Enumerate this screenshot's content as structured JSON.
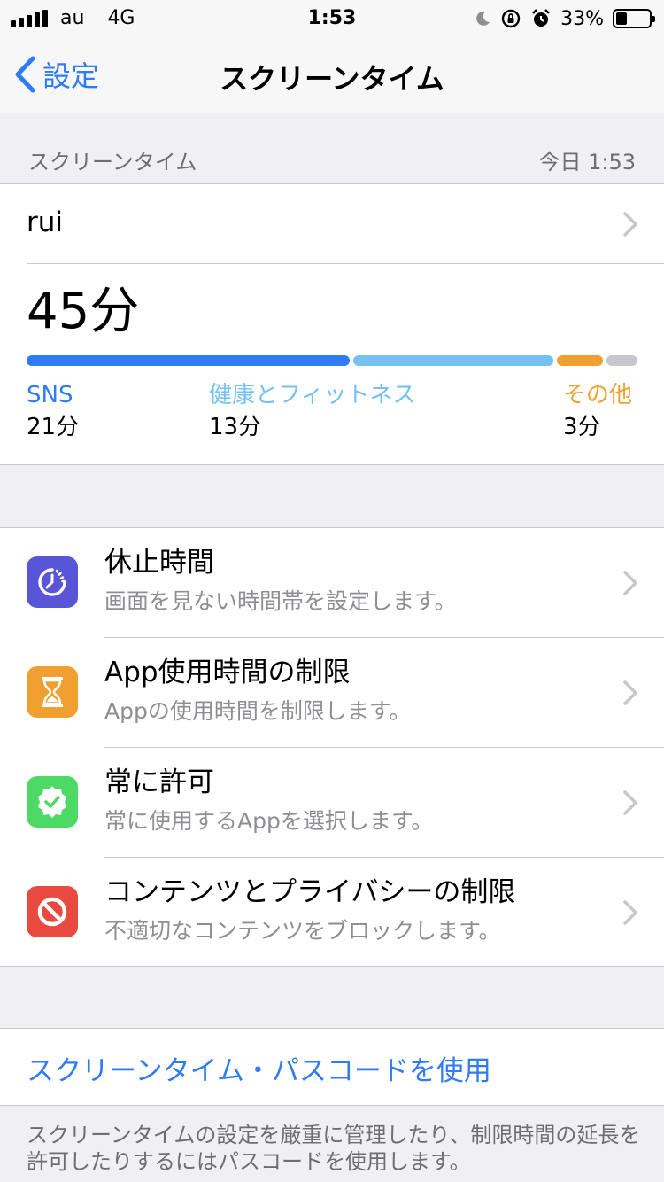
{
  "status_bar": {
    "carrier": "au",
    "network": "4G",
    "time": "1:53",
    "battery_text": "33%",
    "battery_level": 0.33
  },
  "nav": {
    "back_label": "設定",
    "title": "スクリーンタイム"
  },
  "section": {
    "title": "スクリーンタイム",
    "date": "今日 1:53"
  },
  "usage": {
    "user": "rui",
    "total": "45分",
    "segments": [
      {
        "name": "SNS",
        "minutes": 21,
        "color": "#2f7cf6"
      },
      {
        "name": "健康とフィットネス",
        "minutes": 13,
        "color": "#76c1f3"
      },
      {
        "name": "その他",
        "minutes": 3,
        "color": "#f0a030"
      },
      {
        "name": "",
        "minutes": 2,
        "color": "#c7c7cc"
      }
    ],
    "legend": [
      {
        "label": "SNS",
        "value": "21分",
        "color": "#2f7cf6"
      },
      {
        "label": "健康とフィットネス",
        "value": "13分",
        "color": "#76c1f3"
      },
      {
        "label": "その他",
        "value": "3分",
        "color": "#f0a030"
      }
    ]
  },
  "options": [
    {
      "title": "休止時間",
      "subtitle": "画面を見ない時間帯を設定します。",
      "icon": "downtime-icon",
      "color": "#5856d6"
    },
    {
      "title": "App使用時間の制限",
      "subtitle": "Appの使用時間を制限します。",
      "icon": "hourglass-icon",
      "color": "#f0a030"
    },
    {
      "title": "常に許可",
      "subtitle": "常に使用するAppを選択します。",
      "icon": "checkmark-seal-icon",
      "color": "#4cd964"
    },
    {
      "title": "コンテンツとプライバシーの制限",
      "subtitle": "不適切なコンテンツをブロックします。",
      "icon": "prohibited-icon",
      "color": "#e94a3f"
    }
  ],
  "passcode": {
    "label": "スクリーンタイム・パスコードを使用",
    "note": "スクリーンタイムの設定を厳重に管理したり、制限時間の延長を許可したりするにはパスコードを使用します。"
  }
}
